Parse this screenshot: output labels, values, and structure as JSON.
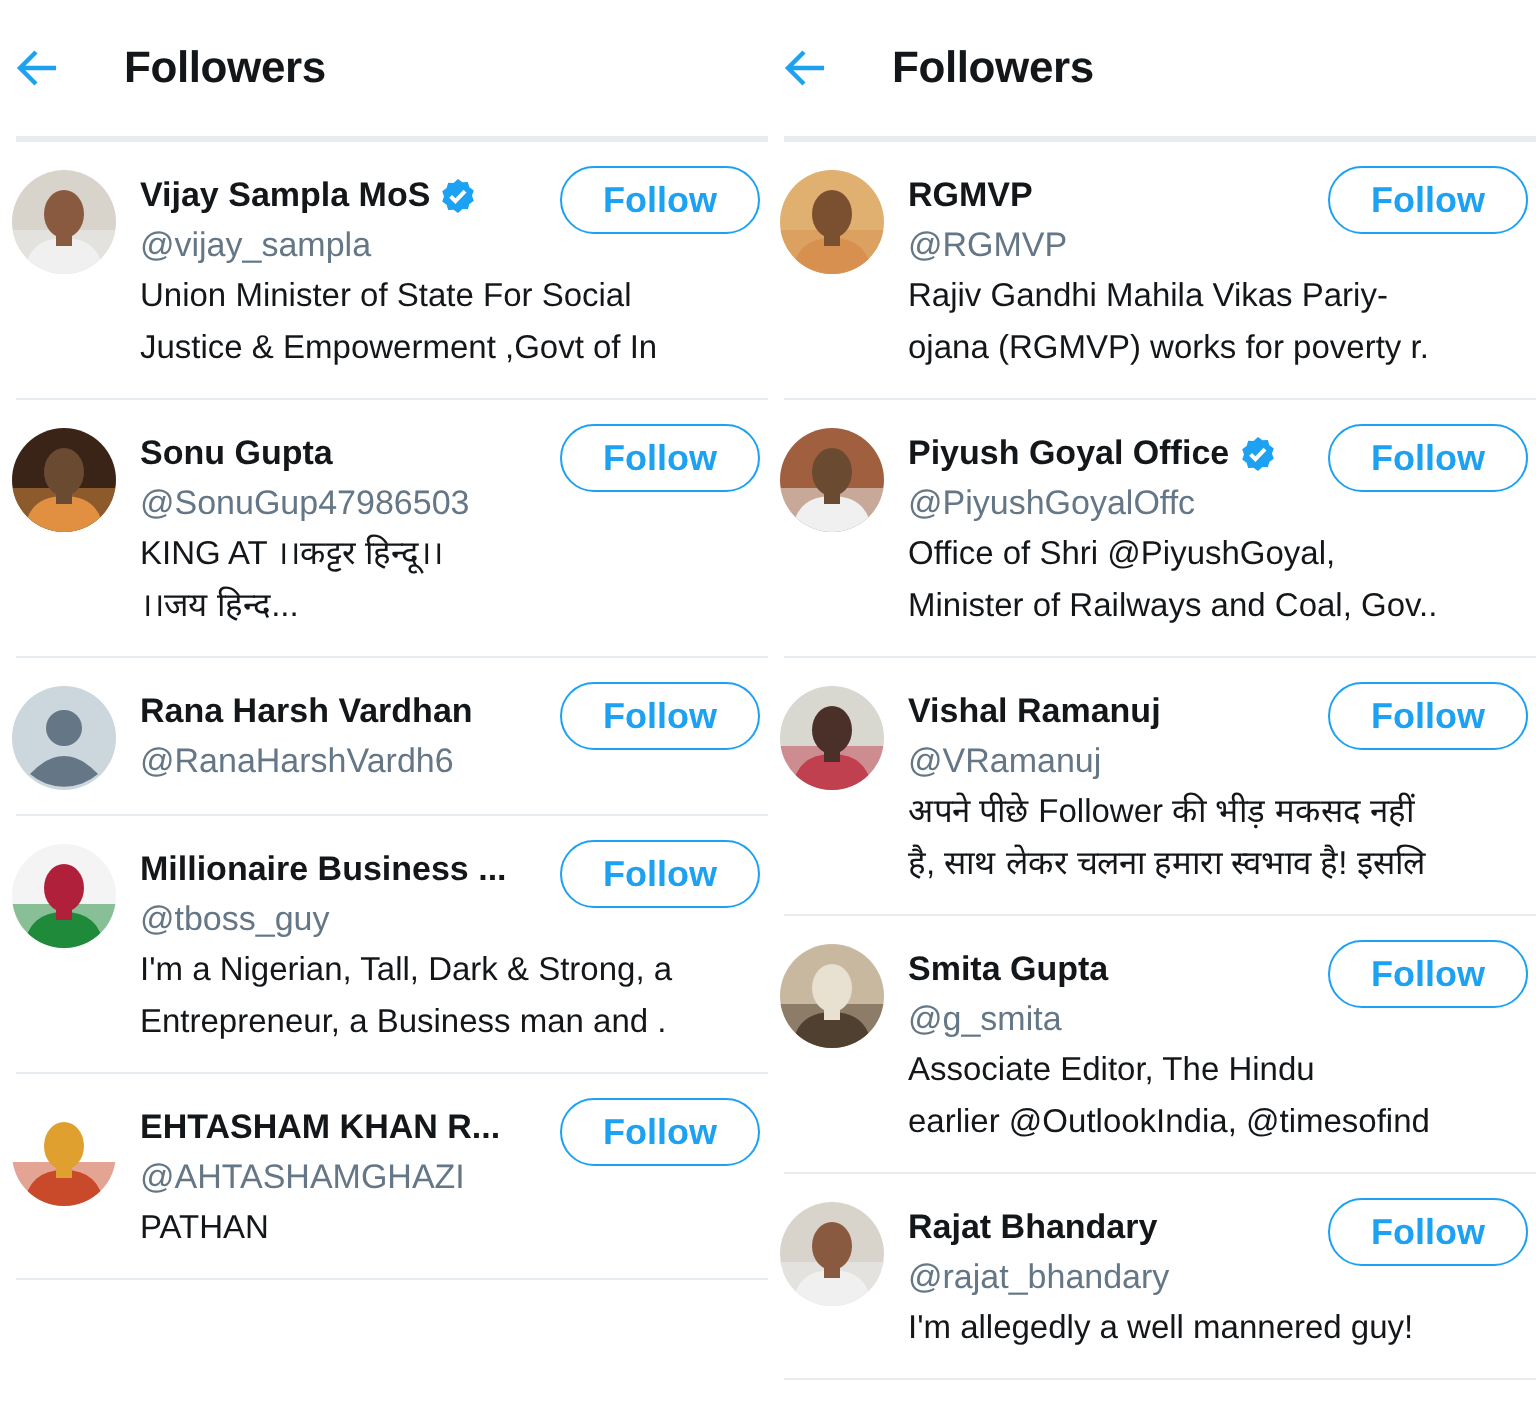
{
  "panels": [
    {
      "title": "Followers",
      "users": [
        {
          "name": "Vijay Sampla MoS",
          "verified": true,
          "handle": "@vijay_sampla",
          "bio": [
            "Union Minister of State For Social",
            "Justice & Empowerment ,Govt of In"
          ],
          "avatar": {
            "kind": "picture"
          },
          "button": "Follow"
        },
        {
          "name": "Sonu Gupta",
          "verified": false,
          "handle": "@SonuGup47986503",
          "bio": [
            "KING AT ।।कट्टर हिन्दू।।",
            "।।जय हिन्द..."
          ],
          "avatar": {
            "kind": "picture"
          },
          "button": "Follow"
        },
        {
          "name": "Rana Harsh Vardhan",
          "verified": false,
          "handle": "@RanaHarshVardh6",
          "avatar": {
            "kind": "default"
          },
          "button": "Follow"
        },
        {
          "name": "Millionaire Business ...",
          "verified": false,
          "handle": "@tboss_guy",
          "bio": [
            "I'm a Nigerian, Tall, Dark & Strong, a",
            "Entrepreneur, a Business man and ."
          ],
          "avatar": {
            "kind": "picture"
          },
          "button": "Follow"
        },
        {
          "name": "EHTASHAM KHAN R...",
          "verified": false,
          "handle": "@AHTASHAMGHAZI",
          "bio": [
            "PATHAN"
          ],
          "avatar": {
            "kind": "picture"
          },
          "button": "Follow"
        }
      ]
    },
    {
      "title": "Followers",
      "users": [
        {
          "name": "RGMVP",
          "verified": false,
          "handle": "@RGMVP",
          "bio": [
            "Rajiv Gandhi Mahila Vikas Pariy-",
            "ojana (RGMVP) works for poverty r."
          ],
          "avatar": {
            "kind": "picture"
          },
          "button": "Follow"
        },
        {
          "name": "Piyush Goyal Office",
          "verified": true,
          "handle": "@PiyushGoyalOffc",
          "bio": [
            "Office of Shri @PiyushGoyal,",
            "Minister of Railways and Coal, Gov.."
          ],
          "avatar": {
            "kind": "picture"
          },
          "button": "Follow"
        },
        {
          "name": "Vishal Ramanuj",
          "verified": false,
          "handle": "@VRamanuj",
          "bio": [
            "अपने पीछे Follower की भीड़ मकसद नहीं",
            "है, साथ लेकर चलना हमारा स्वभाव है! इसलि"
          ],
          "avatar": {
            "kind": "picture"
          },
          "button": "Follow"
        },
        {
          "name": "Smita Gupta",
          "verified": false,
          "handle": "@g_smita",
          "bio": [
            "Associate Editor, The Hindu",
            "earlier @OutlookIndia, @timesofind"
          ],
          "avatar": {
            "kind": "picture"
          },
          "button": "Follow"
        },
        {
          "name": "Rajat Bhandary",
          "verified": false,
          "handle": "@rajat_bhandary",
          "bio": [
            "I'm allegedly a well mannered guy!"
          ],
          "avatar": {
            "kind": "picture"
          },
          "button": "Follow"
        }
      ]
    }
  ]
}
